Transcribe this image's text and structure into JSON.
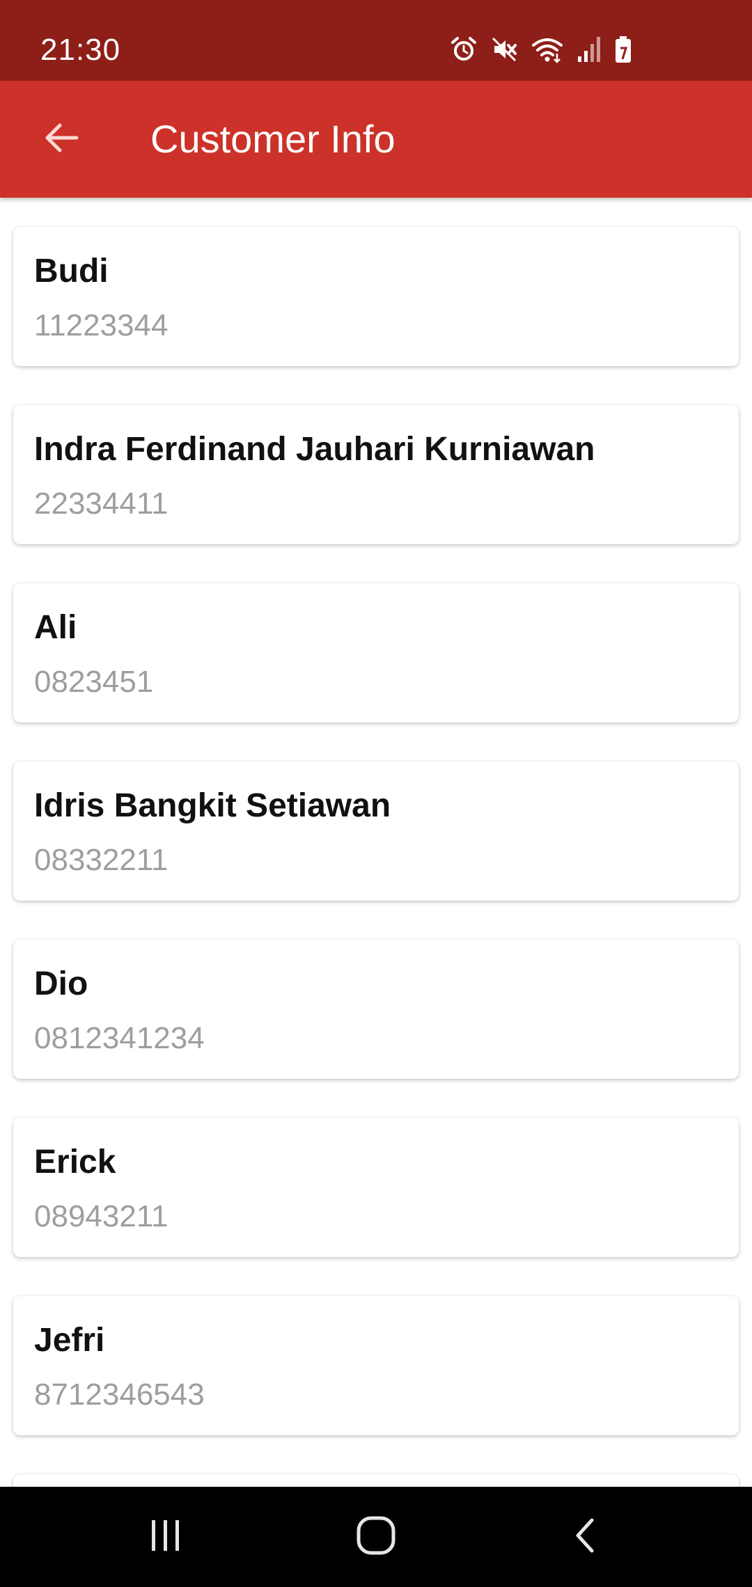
{
  "status_bar": {
    "time": "21:30",
    "icons": [
      "alarm-icon",
      "mute-icon",
      "wifi-icon",
      "signal-icon",
      "battery-icon"
    ],
    "background": "#8e1e18"
  },
  "app_bar": {
    "title": "Customer Info",
    "back_icon": "arrow-left-icon",
    "background": "#cc3229"
  },
  "customers": [
    {
      "name": "Budi",
      "phone": "11223344"
    },
    {
      "name": "Indra Ferdinand Jauhari Kurniawan",
      "phone": "22334411"
    },
    {
      "name": "Ali",
      "phone": "0823451"
    },
    {
      "name": "Idris Bangkit Setiawan",
      "phone": "08332211"
    },
    {
      "name": "Dio",
      "phone": "0812341234"
    },
    {
      "name": "Erick",
      "phone": "08943211"
    },
    {
      "name": "Jefri",
      "phone": "8712346543"
    }
  ],
  "nav_bar": {
    "icons": [
      "recent-apps-icon",
      "home-icon",
      "back-icon"
    ]
  }
}
